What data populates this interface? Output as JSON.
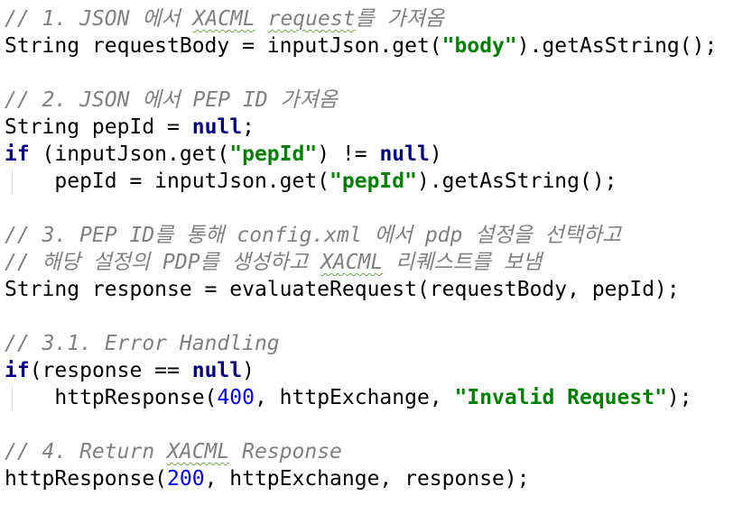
{
  "code": {
    "c1": [
      "// 1. JSON 에서 ",
      "XACML",
      " ",
      "request",
      "를 가져옴"
    ],
    "l2": [
      "String requestBody = inputJson.get(",
      "\"body\"",
      ").getAsString();"
    ],
    "c2": [
      "// 2. JSON 에서 PEP ID 가져옴"
    ],
    "l5": [
      "String pepId = ",
      "null",
      ";"
    ],
    "l6": [
      "if",
      " (inputJson.get(",
      "\"pepId\"",
      ") != ",
      "null",
      ")"
    ],
    "l7": [
      "    pepId = inputJson.get(",
      "\"pepId\"",
      ").getAsString();"
    ],
    "c3": [
      "// 3. PEP ID를 통해 config.xml 에서 pdp 설정을 선택하고"
    ],
    "c3b": [
      "// 해당 설정의 PDP를 생성하고 ",
      "XACML",
      " 리퀘스트를 보냄"
    ],
    "l11": [
      "String response = evaluateRequest(requestBody, pepId);"
    ],
    "c4": [
      "// 3.1. Error Handling"
    ],
    "l14": [
      "if",
      "(response == ",
      "null",
      ")"
    ],
    "l15": [
      "    httpResponse(",
      "400",
      ", httpExchange, ",
      "\"Invalid Request\"",
      ");"
    ],
    "c5": [
      "// 4. Return ",
      "XACML",
      " Response"
    ],
    "l18": [
      "httpResponse(",
      "200",
      ", httpExchange, response);"
    ]
  }
}
